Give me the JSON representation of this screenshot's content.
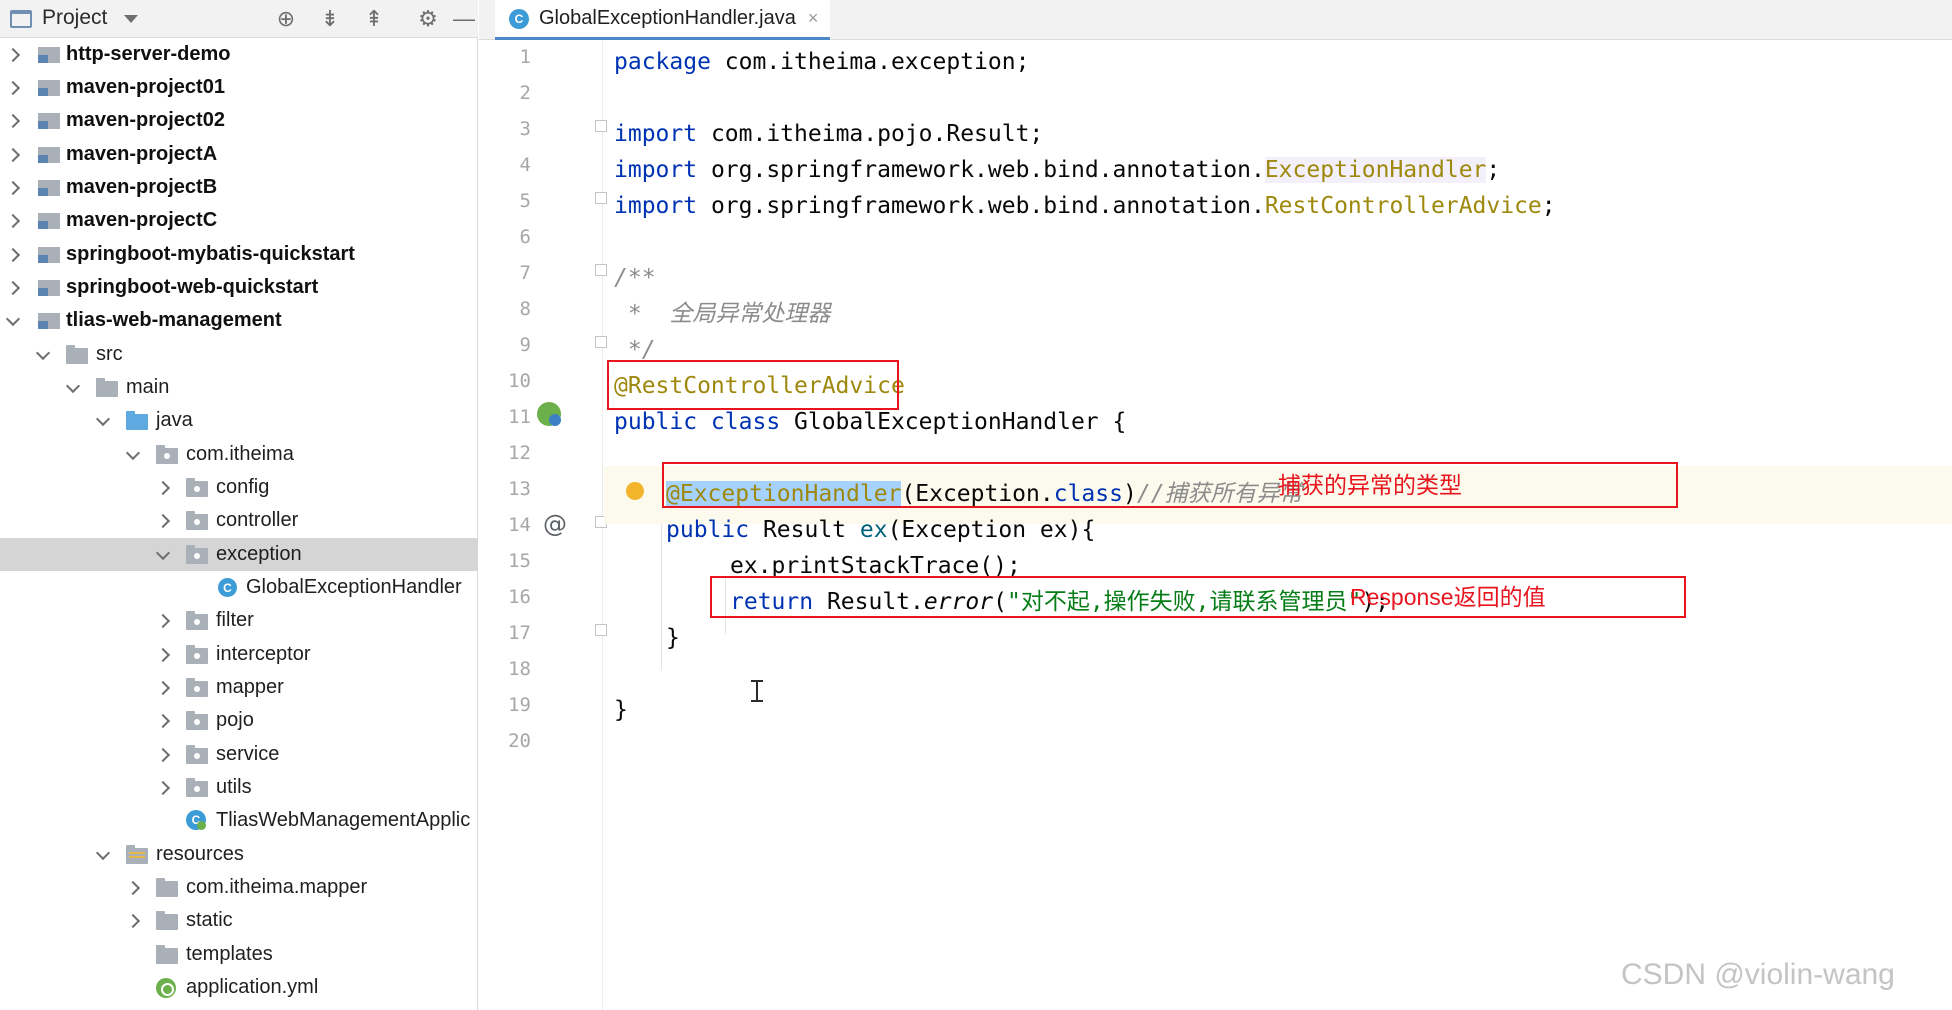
{
  "project_panel": {
    "title": "Project",
    "toolbar_icons": [
      "locate-icon",
      "expand-all-icon",
      "collapse-all-icon",
      "gear-icon",
      "minimize-icon"
    ],
    "tree": [
      {
        "label": "http-server-demo",
        "bold": true,
        "expanded": false
      },
      {
        "label": "maven-project01",
        "bold": true,
        "expanded": false
      },
      {
        "label": "maven-project02",
        "bold": true,
        "expanded": false
      },
      {
        "label": "maven-projectA",
        "bold": true,
        "expanded": false
      },
      {
        "label": "maven-projectB",
        "bold": true,
        "expanded": false
      },
      {
        "label": "maven-projectC",
        "bold": true,
        "expanded": false
      },
      {
        "label": "springboot-mybatis-quickstart",
        "bold": true,
        "expanded": false
      },
      {
        "label": "springboot-web-quickstart",
        "bold": true,
        "expanded": false
      },
      {
        "label": "tlias-web-management",
        "bold": true,
        "expanded": true
      },
      {
        "label": "src",
        "expanded": true
      },
      {
        "label": "main",
        "expanded": true
      },
      {
        "label": "java",
        "expanded": true
      },
      {
        "label": "com.itheima",
        "expanded": true
      },
      {
        "label": "config",
        "expanded": false
      },
      {
        "label": "controller",
        "expanded": false
      },
      {
        "label": "exception",
        "expanded": true,
        "selected": true
      },
      {
        "label": "GlobalExceptionHandler"
      },
      {
        "label": "filter",
        "expanded": false
      },
      {
        "label": "interceptor",
        "expanded": false
      },
      {
        "label": "mapper",
        "expanded": false
      },
      {
        "label": "pojo",
        "expanded": false
      },
      {
        "label": "service",
        "expanded": false
      },
      {
        "label": "utils",
        "expanded": false
      },
      {
        "label": "TliasWebManagementApplic"
      },
      {
        "label": "resources",
        "expanded": true
      },
      {
        "label": "com.itheima.mapper",
        "expanded": false
      },
      {
        "label": "static",
        "expanded": false
      },
      {
        "label": "templates"
      },
      {
        "label": "application.yml"
      }
    ]
  },
  "editor": {
    "tab": {
      "label": "GlobalExceptionHandler.java",
      "close": "×"
    },
    "line_numbers": [
      "1",
      "2",
      "3",
      "4",
      "5",
      "6",
      "7",
      "8",
      "9",
      "10",
      "11",
      "12",
      "13",
      "14",
      "15",
      "16",
      "17",
      "18",
      "19",
      "20"
    ],
    "code": {
      "l1_kw": "package",
      "l1_rest": " com.itheima.exception;",
      "l3_kw": "import",
      "l3_rest": " com.itheima.pojo.Result;",
      "l4_kw": "import",
      "l4_pkg": " org.springframework.web.bind.annotation.",
      "l4_cls": "ExceptionHandler",
      "l4_end": ";",
      "l5_kw": "import",
      "l5_pkg": " org.springframework.web.bind.annotation.",
      "l5_cls": "RestControllerAdvice",
      "l5_end": ";",
      "l7": "/**",
      "l8": " *  全局异常处理器",
      "l9": " */",
      "l10": "@RestControllerAdvice",
      "l11_kw": "public class",
      "l11_rest": " GlobalExceptionHandler {",
      "l13_ann": "@ExceptionHandler",
      "l13_paren": "(Exception.",
      "l13_kw": "class",
      "l13_close": ")",
      "l13_cm": "//捕获所有异常",
      "l14_kw": "public",
      "l14_type": " Result ",
      "l14_fn": "ex",
      "l14_rest": "(Exception ex){",
      "l15": "ex.printStackTrace();",
      "l16_kw": "return",
      "l16_obj": " Result.",
      "l16_fn": "error",
      "l16_open": "(",
      "l16_str": "\"对不起,操作失败,请联系管理员\"",
      "l16_close": ");",
      "l17": "}",
      "l19": "}"
    },
    "annotations": {
      "exception_type_note": "捕获的异常的类型",
      "response_note": "Response返回的值"
    }
  },
  "watermark": "CSDN @violin-wang",
  "colors": {
    "keyword": "#0033b3",
    "annotation": "#9e880d",
    "comment": "#8c8c8c",
    "string": "#067d17",
    "highlight_box": "#e8151f",
    "selection": "#a6d2ff"
  }
}
